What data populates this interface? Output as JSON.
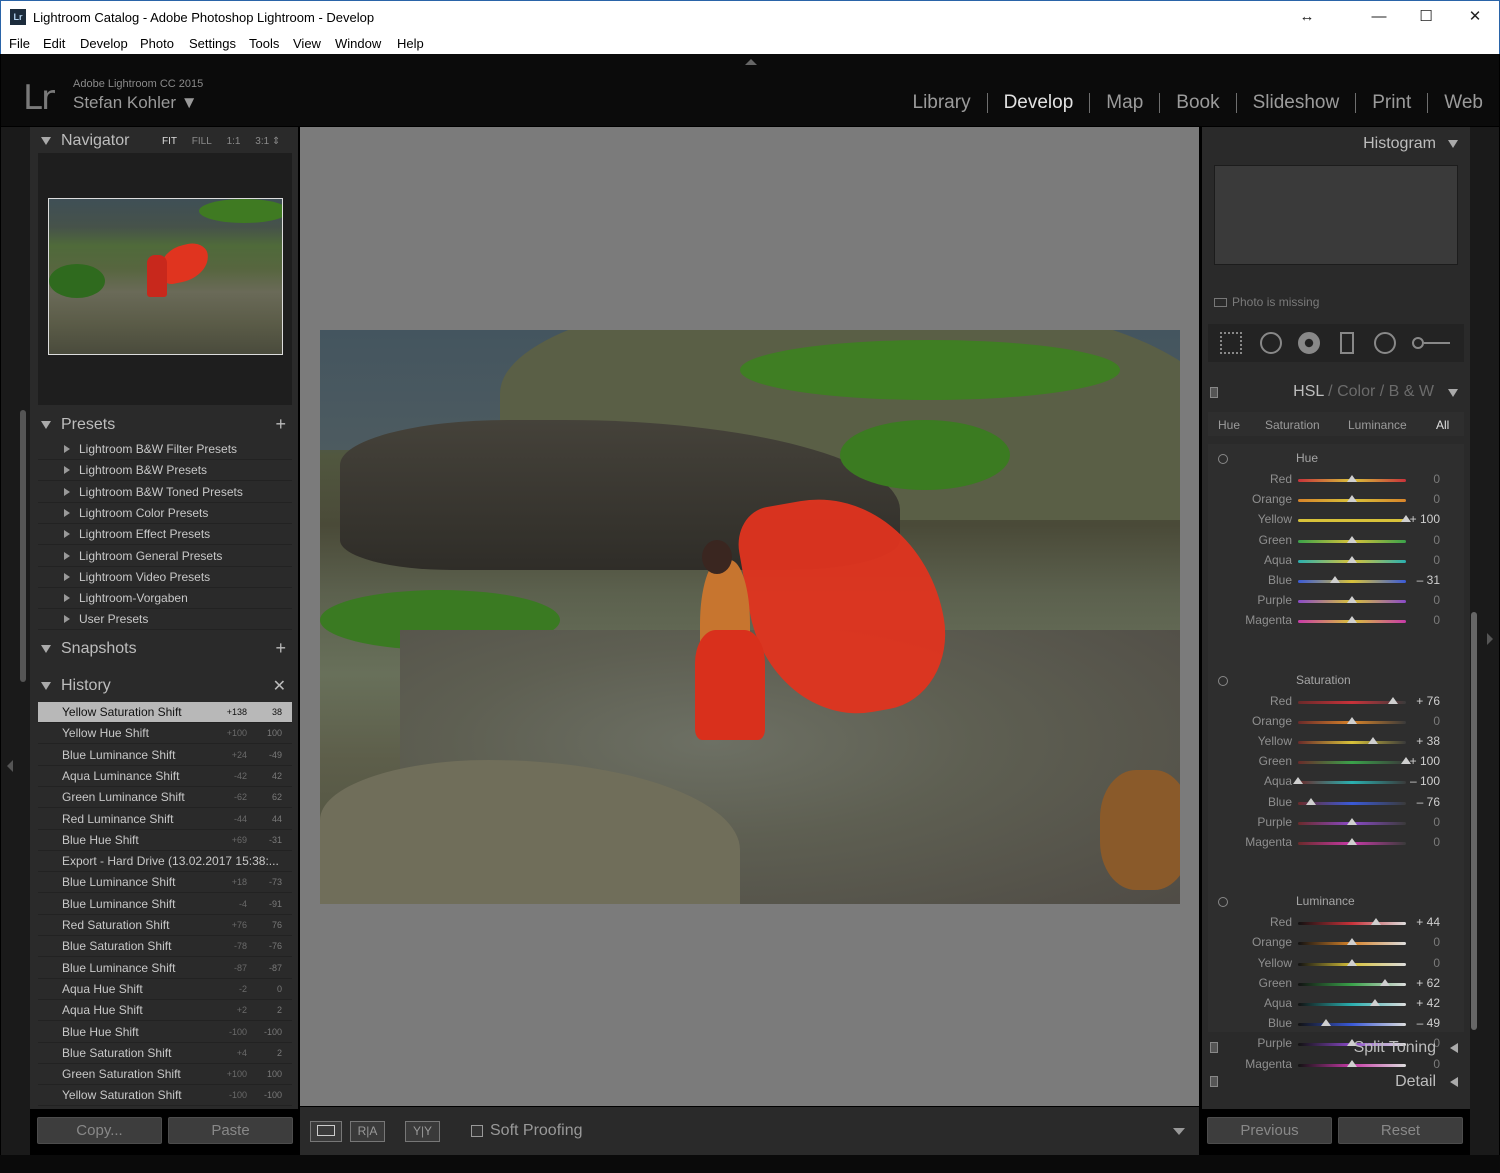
{
  "window": {
    "title": "Lightroom Catalog - Adobe Photoshop Lightroom - Develop",
    "app_icon": "Lr",
    "resize_glyph": "↔",
    "minimize_glyph": "—",
    "maximize_glyph": "☐",
    "close_glyph": "✕"
  },
  "menu": [
    "File",
    "Edit",
    "Develop",
    "Photo",
    "Settings",
    "Tools",
    "View",
    "Window",
    "Help"
  ],
  "identity": {
    "logo": "Lr",
    "product": "Adobe Lightroom CC 2015",
    "user": "Stefan Kohler ▼"
  },
  "modules": [
    "Library",
    "Develop",
    "Map",
    "Book",
    "Slideshow",
    "Print",
    "Web"
  ],
  "active_module": "Develop",
  "navigator": {
    "title": "Navigator",
    "zoom_options": [
      "FIT",
      "FILL",
      "1:1",
      "3:1 ⇕"
    ],
    "active_zoom": "FIT"
  },
  "presets": {
    "title": "Presets",
    "items": [
      "Lightroom B&W Filter Presets",
      "Lightroom B&W Presets",
      "Lightroom B&W Toned Presets",
      "Lightroom Color Presets",
      "Lightroom Effect Presets",
      "Lightroom General Presets",
      "Lightroom Video Presets",
      "Lightroom-Vorgaben",
      "User Presets"
    ]
  },
  "snapshots": {
    "title": "Snapshots"
  },
  "history": {
    "title": "History",
    "items": [
      {
        "label": "Yellow Saturation Shift",
        "delta": "+138",
        "value": "38"
      },
      {
        "label": "Yellow Hue Shift",
        "delta": "+100",
        "value": "100"
      },
      {
        "label": "Blue Luminance Shift",
        "delta": "+24",
        "value": "-49"
      },
      {
        "label": "Aqua Luminance Shift",
        "delta": "-42",
        "value": "42"
      },
      {
        "label": "Green Luminance Shift",
        "delta": "-62",
        "value": "62"
      },
      {
        "label": "Red Luminance Shift",
        "delta": "-44",
        "value": "44"
      },
      {
        "label": "Blue Hue Shift",
        "delta": "+69",
        "value": "-31"
      },
      {
        "label": "Export - Hard Drive (13.02.2017 15:38:...",
        "delta": "",
        "value": ""
      },
      {
        "label": "Blue Luminance Shift",
        "delta": "+18",
        "value": "-73"
      },
      {
        "label": "Blue Luminance Shift",
        "delta": "-4",
        "value": "-91"
      },
      {
        "label": "Red Saturation Shift",
        "delta": "+76",
        "value": "76"
      },
      {
        "label": "Blue Saturation Shift",
        "delta": "-78",
        "value": "-76"
      },
      {
        "label": "Blue Luminance Shift",
        "delta": "-87",
        "value": "-87"
      },
      {
        "label": "Aqua Hue Shift",
        "delta": "-2",
        "value": "0"
      },
      {
        "label": "Aqua Hue Shift",
        "delta": "+2",
        "value": "2"
      },
      {
        "label": "Blue Hue Shift",
        "delta": "-100",
        "value": "-100"
      },
      {
        "label": "Blue Saturation Shift",
        "delta": "+4",
        "value": "2"
      },
      {
        "label": "Green Saturation Shift",
        "delta": "+100",
        "value": "100"
      },
      {
        "label": "Yellow Saturation Shift",
        "delta": "-100",
        "value": "-100"
      }
    ]
  },
  "left_buttons": {
    "copy": "Copy...",
    "paste": "Paste"
  },
  "toolbar": {
    "view_ra": "R|A",
    "view_yy": "Y|Y",
    "soft_proofing": "Soft Proofing"
  },
  "histogram": {
    "title": "Histogram",
    "missing": "Photo is missing"
  },
  "tool_icons": [
    "crop-overlay-icon",
    "spot-removal-icon",
    "red-eye-icon",
    "graduated-filter-icon",
    "radial-filter-icon",
    "adjustment-brush-icon"
  ],
  "hsl": {
    "title_parts": [
      "HSL",
      "Color",
      "B & W"
    ],
    "sep": "/",
    "tabs": [
      "Hue",
      "Saturation",
      "Luminance",
      "All"
    ],
    "active_tab": "All",
    "groups": [
      {
        "name": "Hue",
        "rows": [
          {
            "label": "Red",
            "value": 0,
            "display": "0"
          },
          {
            "label": "Orange",
            "value": 0,
            "display": "0"
          },
          {
            "label": "Yellow",
            "value": 100,
            "display": "+ 100"
          },
          {
            "label": "Green",
            "value": 0,
            "display": "0"
          },
          {
            "label": "Aqua",
            "value": 0,
            "display": "0"
          },
          {
            "label": "Blue",
            "value": -31,
            "display": "– 31"
          },
          {
            "label": "Purple",
            "value": 0,
            "display": "0"
          },
          {
            "label": "Magenta",
            "value": 0,
            "display": "0"
          }
        ]
      },
      {
        "name": "Saturation",
        "rows": [
          {
            "label": "Red",
            "value": 76,
            "display": "+ 76"
          },
          {
            "label": "Orange",
            "value": 0,
            "display": "0"
          },
          {
            "label": "Yellow",
            "value": 38,
            "display": "+ 38"
          },
          {
            "label": "Green",
            "value": 100,
            "display": "+ 100"
          },
          {
            "label": "Aqua",
            "value": -100,
            "display": "– 100"
          },
          {
            "label": "Blue",
            "value": -76,
            "display": "– 76"
          },
          {
            "label": "Purple",
            "value": 0,
            "display": "0"
          },
          {
            "label": "Magenta",
            "value": 0,
            "display": "0"
          }
        ]
      },
      {
        "name": "Luminance",
        "rows": [
          {
            "label": "Red",
            "value": 44,
            "display": "+ 44"
          },
          {
            "label": "Orange",
            "value": 0,
            "display": "0"
          },
          {
            "label": "Yellow",
            "value": 0,
            "display": "0"
          },
          {
            "label": "Green",
            "value": 62,
            "display": "+ 62"
          },
          {
            "label": "Aqua",
            "value": 42,
            "display": "+ 42"
          },
          {
            "label": "Blue",
            "value": -49,
            "display": "– 49"
          },
          {
            "label": "Purple",
            "value": 0,
            "display": "0"
          },
          {
            "label": "Magenta",
            "value": 0,
            "display": "0"
          }
        ]
      }
    ]
  },
  "split_toning": {
    "title": "Split Toning"
  },
  "detail": {
    "title": "Detail"
  },
  "right_buttons": {
    "previous": "Previous",
    "reset": "Reset"
  },
  "colors": {
    "Red": "#c8323a",
    "Orange": "#d8842a",
    "Yellow": "#d8c23a",
    "Green": "#3aa24a",
    "Aqua": "#2ab0b0",
    "Blue": "#3a5ad8",
    "Purple": "#8a4ac8",
    "Magenta": "#c83aa8"
  }
}
